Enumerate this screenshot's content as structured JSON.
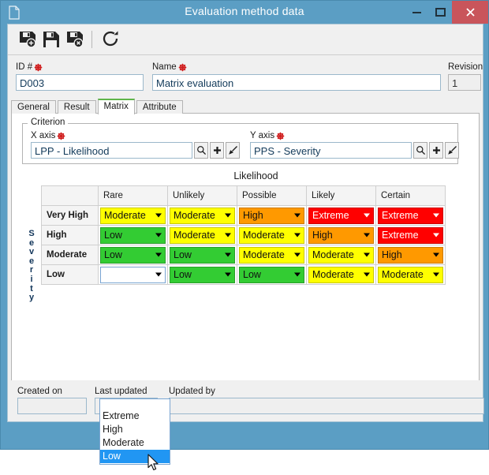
{
  "window": {
    "title": "Evaluation method data",
    "doc_icon": "document-icon",
    "minimize_label": "–",
    "maximize_label": "□",
    "close_label": "✕"
  },
  "toolbar": {
    "buttons": [
      {
        "name": "save-new-button",
        "icon": "save-new-icon",
        "tooltip": "Save as new"
      },
      {
        "name": "save-button",
        "icon": "save-icon",
        "tooltip": "Save"
      },
      {
        "name": "save-delete-button",
        "icon": "save-delete-icon",
        "tooltip": "Delete"
      },
      {
        "name": "refresh-button",
        "icon": "refresh-icon",
        "tooltip": "Refresh"
      }
    ]
  },
  "header": {
    "id_label": "ID #",
    "id_value": "D003",
    "name_label": "Name",
    "name_value": "Matrix evaluation",
    "revision_label": "Revision",
    "revision_value": "1",
    "required_marker": "required-icon"
  },
  "tabs": [
    {
      "label": "General",
      "active": false
    },
    {
      "label": "Result",
      "active": false
    },
    {
      "label": "Matrix",
      "active": true
    },
    {
      "label": "Attribute",
      "active": false
    }
  ],
  "criterion": {
    "title": "Criterion",
    "x_axis": {
      "label": "X axis",
      "value": "LPP - Likelihood",
      "buttons": [
        "search-icon",
        "plus-icon",
        "clear-brush-icon"
      ]
    },
    "y_axis": {
      "label": "Y axis",
      "value": "PPS - Severity",
      "buttons": [
        "search-icon",
        "plus-icon",
        "clear-brush-icon"
      ]
    }
  },
  "matrix": {
    "x_caption": "Likelihood",
    "y_caption": "Severity",
    "columns": [
      "Rare",
      "Unlikely",
      "Possible",
      "Likely",
      "Certain"
    ],
    "rows": [
      {
        "header": "Very High",
        "cells": [
          {
            "value": "Moderate",
            "color": "yellow"
          },
          {
            "value": "Moderate",
            "color": "yellow"
          },
          {
            "value": "High",
            "color": "orange"
          },
          {
            "value": "Extreme",
            "color": "red"
          },
          {
            "value": "Extreme",
            "color": "red"
          }
        ]
      },
      {
        "header": "High",
        "cells": [
          {
            "value": "Low",
            "color": "green"
          },
          {
            "value": "Moderate",
            "color": "yellow"
          },
          {
            "value": "Moderate",
            "color": "yellow"
          },
          {
            "value": "High",
            "color": "orange"
          },
          {
            "value": "Extreme",
            "color": "red"
          }
        ]
      },
      {
        "header": "Moderate",
        "cells": [
          {
            "value": "Low",
            "color": "green"
          },
          {
            "value": "Low",
            "color": "green"
          },
          {
            "value": "Moderate",
            "color": "yellow"
          },
          {
            "value": "Moderate",
            "color": "yellow"
          },
          {
            "value": "High",
            "color": "orange"
          }
        ]
      },
      {
        "header": "Low",
        "cells": [
          {
            "value": "",
            "color": "empty"
          },
          {
            "value": "Low",
            "color": "green"
          },
          {
            "value": "Low",
            "color": "green"
          },
          {
            "value": "Moderate",
            "color": "yellow"
          },
          {
            "value": "Moderate",
            "color": "yellow"
          }
        ]
      }
    ]
  },
  "dropdown": {
    "open": true,
    "options": [
      "Extreme",
      "High",
      "Moderate",
      "Low"
    ],
    "selected": "Low"
  },
  "footer": {
    "created_on_label": "Created on",
    "created_on_value": "",
    "last_updated_label": "Last updated",
    "last_updated_value": "",
    "updated_by_label": "Updated by",
    "updated_by_value": ""
  },
  "colors": {
    "titlebar": "#5b9ec4",
    "close": "#c9555b",
    "green": "#33cc33",
    "yellow": "#ffff00",
    "orange": "#ff9900",
    "red": "#ff0000",
    "accent_tab": "#5fb54a",
    "highlight": "#2196f3"
  }
}
